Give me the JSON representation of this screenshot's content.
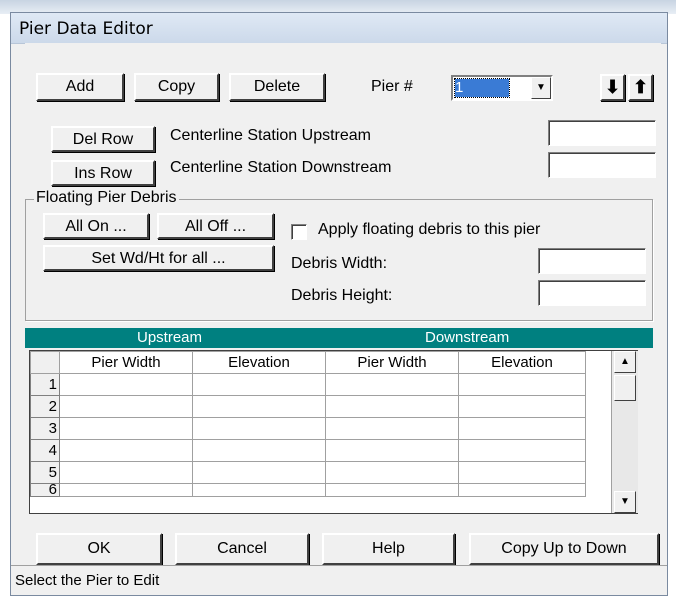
{
  "window": {
    "title": "Pier Data Editor"
  },
  "toolbar": {
    "add": "Add",
    "copy": "Copy",
    "delete": "Delete",
    "pier_label": "Pier #",
    "pier_value": "1",
    "down_arrow": "⬇",
    "up_arrow": "⬆"
  },
  "rows": {
    "del_row": "Del Row",
    "ins_row": "Ins Row",
    "centerline_upstream": "Centerline Station Upstream",
    "centerline_downstream": "Centerline Station Downstream",
    "centerline_upstream_value": "",
    "centerline_downstream_value": ""
  },
  "debris": {
    "legend": "Floating Pier Debris",
    "all_on": "All On ...",
    "all_off": "All Off ...",
    "set_wd_ht": "Set Wd/Ht for all ...",
    "apply_label": "Apply floating debris to this pier",
    "apply_checked": false,
    "width_label": "Debris Width:",
    "height_label": "Debris Height:",
    "width_value": "",
    "height_value": ""
  },
  "grid": {
    "group_upstream": "Upstream",
    "group_downstream": "Downstream",
    "columns": [
      "Pier Width",
      "Elevation",
      "Pier Width",
      "Elevation"
    ],
    "row_numbers": [
      "1",
      "2",
      "3",
      "4",
      "5",
      "6"
    ]
  },
  "buttons": {
    "ok": "OK",
    "cancel": "Cancel",
    "help": "Help",
    "copy_up_to_down": "Copy Up to Down"
  },
  "status": {
    "text": "Select the Pier to Edit"
  },
  "colors": {
    "grid_header": "#008080",
    "selection": "#3a7bd5"
  }
}
